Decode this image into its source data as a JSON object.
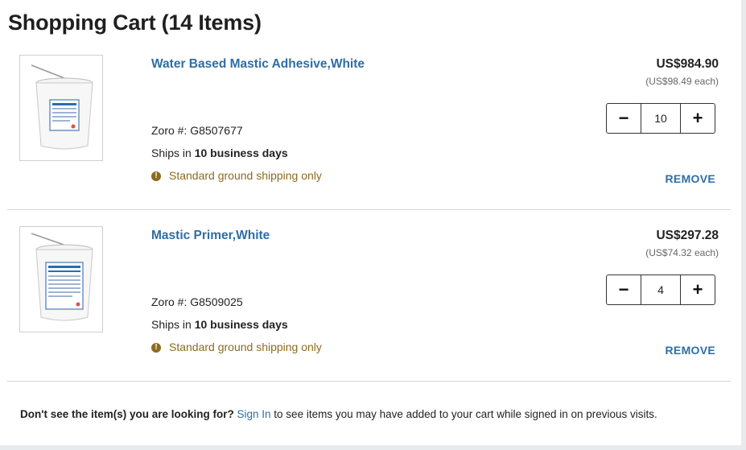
{
  "page_title": "Shopping Cart (14 Items)",
  "items": [
    {
      "name": "Water Based Mastic Adhesive,White",
      "sku_label": "Zoro #: ",
      "sku": "G8507677",
      "ships_prefix": "Ships in ",
      "ships_days": "10 business days",
      "notice": "Standard ground shipping only",
      "price": "US$984.90",
      "each": "(US$98.49 each)",
      "quantity": "10",
      "remove_label": "REMOVE",
      "image_icon": "bucket-icon",
      "label_color": "#2b6cb0"
    },
    {
      "name": "Mastic Primer,White",
      "sku_label": "Zoro #: ",
      "sku": "G8509025",
      "ships_prefix": "Ships in ",
      "ships_days": "10 business days",
      "notice": "Standard ground shipping only",
      "price": "US$297.28",
      "each": "(US$74.32 each)",
      "quantity": "4",
      "remove_label": "REMOVE",
      "image_icon": "bucket-icon",
      "label_color": "#2b6cb0"
    }
  ],
  "footer": {
    "question": "Don't see the item(s) you are looking for?",
    "signin": "Sign In",
    "rest": " to see items you may have added to your cart while signed in on previous visits."
  },
  "colors": {
    "link": "#2f6ea3",
    "notice": "#8d6b1e"
  }
}
